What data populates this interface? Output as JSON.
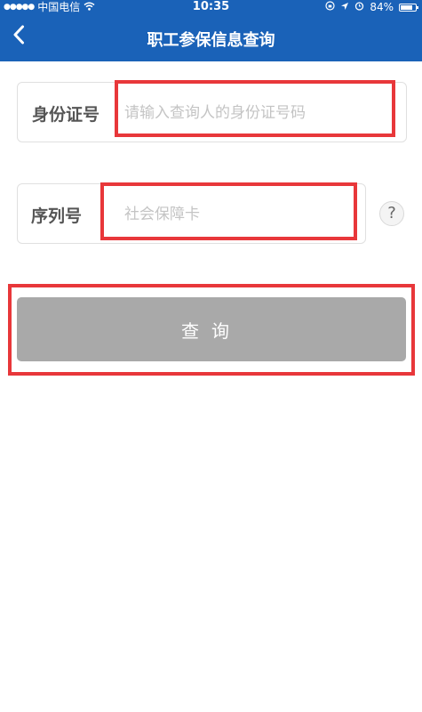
{
  "status_bar": {
    "signal": "●●●●●",
    "carrier": "中国电信",
    "wifi_icon": "wifi-icon",
    "time": "10:35",
    "battery_percent": "84%",
    "battery_level": 0.84
  },
  "nav": {
    "title": "职工参保信息查询",
    "back_icon": "chevron-left-icon"
  },
  "form": {
    "id_label": "身份证号",
    "id_placeholder": "请输入查询人的身份证号码",
    "id_value": "",
    "serial_label": "序列号",
    "serial_placeholder": "社会保障卡",
    "serial_value": "",
    "help_symbol": "?",
    "submit_label": "查询"
  },
  "colors": {
    "header": "#1a62b8",
    "button": "#a9a9a9",
    "highlight": "#e8373a"
  }
}
